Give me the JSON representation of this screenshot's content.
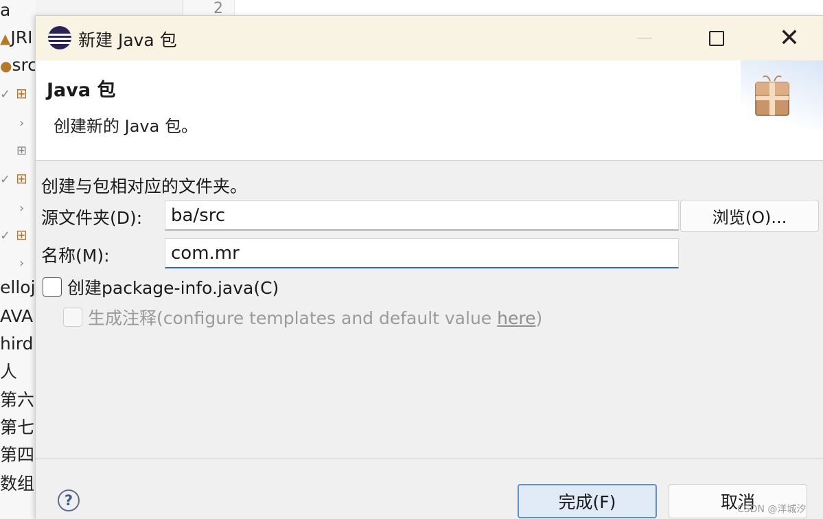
{
  "background": {
    "editor_line_number": "2",
    "explorer_items": [
      "a",
      "JRI",
      "src",
      "",
      "",
      "",
      "",
      "",
      "",
      "",
      "elloj",
      "AVA",
      "hird",
      "人",
      "第六章",
      "第七章",
      "第四次",
      "数组"
    ]
  },
  "dialog": {
    "title": "新建 Java 包",
    "banner": {
      "title": "Java 包",
      "description": "创建新的 Java 包。"
    },
    "section_description": "创建与包相对应的文件夹。",
    "source_folder": {
      "label": "源文件夹(D):",
      "value": "ba/src",
      "browse_label": "浏览(O)..."
    },
    "name": {
      "label": "名称(M):",
      "value": "com.mr"
    },
    "package_info_checkbox": {
      "label": "创建package-info.java(C)",
      "checked": false
    },
    "comments_checkbox": {
      "label": "生成注释",
      "hint_prefix": "(configure templates and default value ",
      "hint_link": "here",
      "hint_suffix": ")",
      "checked": false,
      "enabled": false
    },
    "buttons": {
      "finish": "完成(F)",
      "cancel": "取消"
    },
    "help_glyph": "?"
  },
  "watermark": "CSDN @洋城汐",
  "colors": {
    "titlebar_bg": "#f9f3e3",
    "focus_accent": "#2a6ad2",
    "default_button_bg": "#e1ebf8"
  },
  "icons": [
    "eclipse-logo-icon",
    "minimize-icon",
    "maximize-icon",
    "close-icon",
    "package-wizard-icon",
    "help-icon",
    "chevron-icon",
    "package-icon"
  ]
}
